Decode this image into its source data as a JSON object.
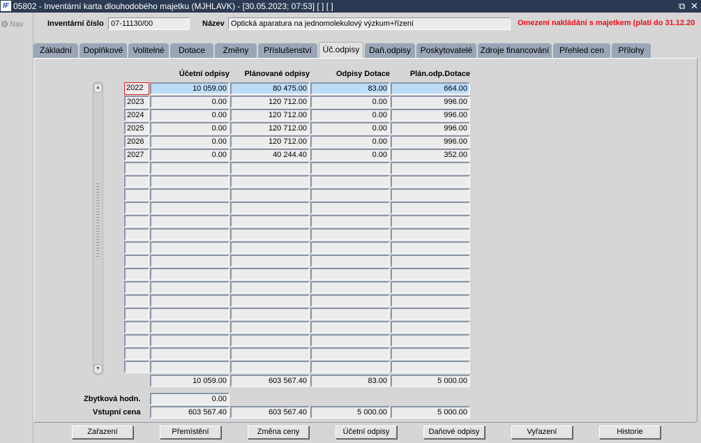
{
  "window": {
    "logo": "IF",
    "title": "05802 - Inventární karta dlouhodobého majetku (MJHLAVK) - [30.05.2023; 07:53]  [ ]  [ ]",
    "restore_icon": "restore-icon",
    "close_icon": "close-icon"
  },
  "nav": {
    "label": "Nav"
  },
  "header": {
    "inv_label": "Inventární číslo",
    "inv_value": "07-11130/00",
    "name_label": "Název",
    "name_value": "Optická aparatura na jednomolekulový výzkum+řízení",
    "warning": "Omezení nakládání s majetkem (platí do 31.12.20"
  },
  "tabs": [
    "Základní",
    "Doplňkové",
    "Volitelné",
    "Dotace",
    "Změny",
    "Příslušenství",
    "Úč.odpisy",
    "Daň.odpisy",
    "Poskytovatelé",
    "Zdroje financování",
    "Přehled cen",
    "Přílohy"
  ],
  "active_tab": "Úč.odpisy",
  "table": {
    "headers": [
      "Účetní odpisy",
      "Plánované odpisy",
      "Odpisy Dotace",
      "Plán.odp.Dotace"
    ],
    "rows": [
      [
        "2022",
        "10 059.00",
        "80 475.00",
        "83.00",
        "664.00"
      ],
      [
        "2023",
        "0.00",
        "120 712.00",
        "0.00",
        "996.00"
      ],
      [
        "2024",
        "0.00",
        "120 712.00",
        "0.00",
        "996.00"
      ],
      [
        "2025",
        "0.00",
        "120 712.00",
        "0.00",
        "996.00"
      ],
      [
        "2026",
        "0.00",
        "120 712.00",
        "0.00",
        "996.00"
      ],
      [
        "2027",
        "0.00",
        "40 244.40",
        "0.00",
        "352.00"
      ]
    ],
    "empty_rows": 16,
    "totals": [
      "10 059.00",
      "603 567.40",
      "83.00",
      "5 000.00"
    ]
  },
  "summary": {
    "residual_label": "Zbytková hodn.",
    "residual_value": "0.00",
    "input_label": "Vstupní cena",
    "input_values": [
      "603 567.40",
      "603 567.40",
      "5 000.00",
      "5 000.00"
    ]
  },
  "buttons": [
    "Zařazení",
    "Přemístění",
    "Změna ceny",
    "Účetní odpisy",
    "Daňové odpisy",
    "Vyřazení",
    "Historie"
  ]
}
